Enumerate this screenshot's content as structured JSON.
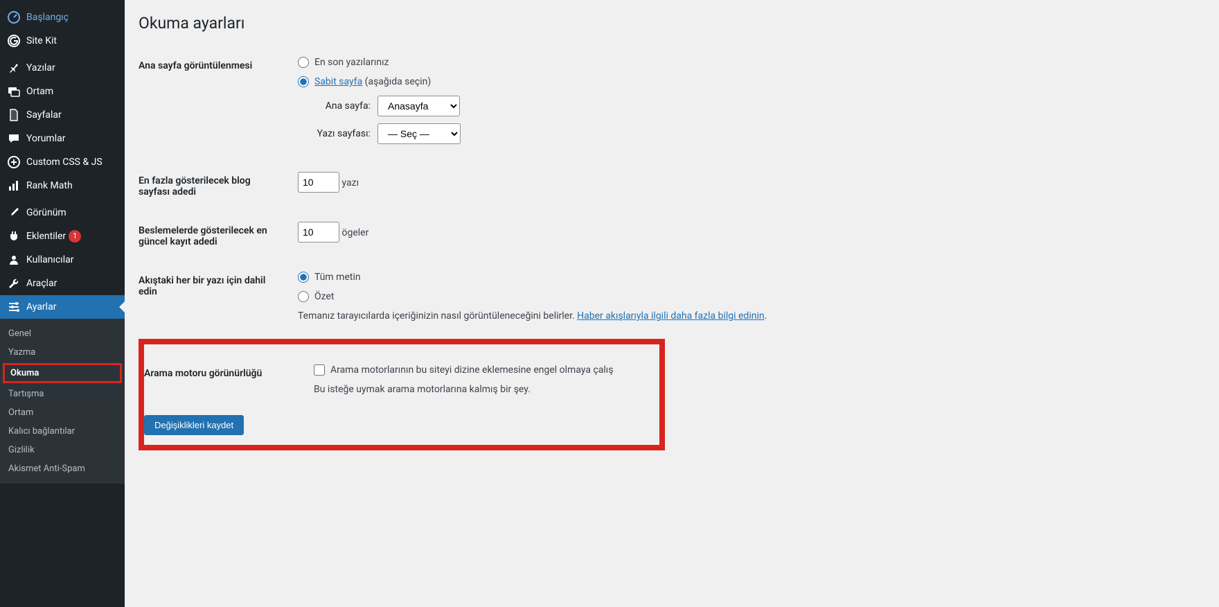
{
  "sidebar": {
    "items": [
      {
        "label": "Başlangıç",
        "icon": "dashboard",
        "accent": true
      },
      {
        "label": "Site Kit",
        "icon": "g"
      },
      {
        "sep": true
      },
      {
        "label": "Yazılar",
        "icon": "pin"
      },
      {
        "label": "Ortam",
        "icon": "media"
      },
      {
        "label": "Sayfalar",
        "icon": "page"
      },
      {
        "label": "Yorumlar",
        "icon": "comment"
      },
      {
        "label": "Custom CSS & JS",
        "icon": "plus-circle"
      },
      {
        "label": "Rank Math",
        "icon": "chart"
      },
      {
        "sep": true
      },
      {
        "label": "Görünüm",
        "icon": "brush"
      },
      {
        "label": "Eklentiler",
        "icon": "plugin",
        "badge": "1"
      },
      {
        "label": "Kullanıcılar",
        "icon": "user"
      },
      {
        "label": "Araçlar",
        "icon": "wrench"
      },
      {
        "label": "Ayarlar",
        "icon": "sliders",
        "active": true
      }
    ],
    "submenu": [
      {
        "label": "Genel"
      },
      {
        "label": "Yazma"
      },
      {
        "label": "Okuma",
        "current": true
      },
      {
        "label": "Tartışma"
      },
      {
        "label": "Ortam"
      },
      {
        "label": "Kalıcı bağlantılar"
      },
      {
        "label": "Gizlilik"
      },
      {
        "label": "Akismet Anti-Spam"
      }
    ]
  },
  "page": {
    "title": "Okuma ayarları",
    "homepage_display": {
      "row_label": "Ana sayfa görüntülenmesi",
      "option_latest": "En son yazılarınız",
      "option_static": "Sabit sayfa",
      "option_static_suffix": " (aşağıda seçin)",
      "front_label": "Ana sayfa:",
      "front_value": "Anasayfa",
      "posts_label": "Yazı sayfası:",
      "posts_value": "— Seç —"
    },
    "posts_per_page": {
      "row_label": "En fazla gösterilecek blog sayfası adedi",
      "value": "10",
      "suffix": "yazı"
    },
    "feed_items": {
      "row_label": "Beslemelerde gösterilecek en güncel kayıt adedi",
      "value": "10",
      "suffix": "ögeler"
    },
    "feed_content": {
      "row_label": "Akıştaki her bir yazı için dahil edin",
      "option_full": "Tüm metin",
      "option_summary": "Özet",
      "note_prefix": "Temanız tarayıcılarda içeriğinizin nasıl görüntüleneceğini belirler. ",
      "note_link": "Haber akışlarıyla ilgili daha fazla bilgi edinin",
      "note_suffix": "."
    },
    "search_visibility": {
      "row_label": "Arama motoru görünürlüğü",
      "checkbox_label": "Arama motorlarının bu siteyi dizine eklemesine engel olmaya çalış",
      "note": "Bu isteğe uymak arama motorlarına kalmış bir şey."
    },
    "submit_label": "Değişiklikleri kaydet"
  }
}
